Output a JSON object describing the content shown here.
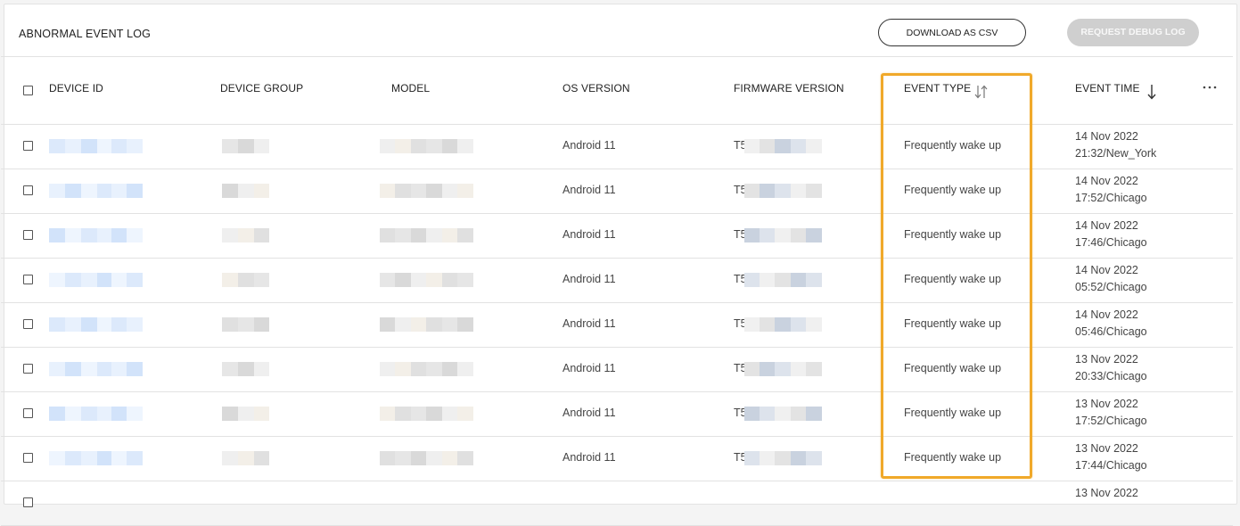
{
  "page": {
    "title": "ABNORMAL EVENT LOG",
    "download_label": "DOWNLOAD AS CSV",
    "debug_label": "REQUEST DEBUG LOG"
  },
  "columns": {
    "device_id": "DEVICE ID",
    "device_group": "DEVICE GROUP",
    "model": "MODEL",
    "os_version": "OS VERSION",
    "firmware_version": "FIRMWARE VERSION",
    "event_type": "EVENT TYPE",
    "event_time": "EVENT TIME"
  },
  "icons": {
    "event_type_sort": "sort-both-icon",
    "event_time_sort": "sort-descending-icon",
    "column_menu": "more-horizontal-icon"
  },
  "colors": {
    "highlight": "#f0a92a",
    "disabled_button": "#cfcfcf",
    "redacted_blue": "#d8e8fb",
    "redacted_gray": "#e4e4e4"
  },
  "rows": [
    {
      "os": "Android 11",
      "firmware_prefix": "T5",
      "event": "Frequently wake up",
      "date": "14 Nov 2022",
      "time": "21:32/New_York"
    },
    {
      "os": "Android 11",
      "firmware_prefix": "T5",
      "event": "Frequently wake up",
      "date": "14 Nov 2022",
      "time": "17:52/Chicago"
    },
    {
      "os": "Android 11",
      "firmware_prefix": "T5",
      "event": "Frequently wake up",
      "date": "14 Nov 2022",
      "time": "17:46/Chicago"
    },
    {
      "os": "Android 11",
      "firmware_prefix": "T5",
      "event": "Frequently wake up",
      "date": "14 Nov 2022",
      "time": "05:52/Chicago"
    },
    {
      "os": "Android 11",
      "firmware_prefix": "T5",
      "event": "Frequently wake up",
      "date": "14 Nov 2022",
      "time": "05:46/Chicago"
    },
    {
      "os": "Android 11",
      "firmware_prefix": "T5",
      "event": "Frequently wake up",
      "date": "13 Nov 2022",
      "time": "20:33/Chicago"
    },
    {
      "os": "Android 11",
      "firmware_prefix": "T5",
      "event": "Frequently wake up",
      "date": "13 Nov 2022",
      "time": "17:52/Chicago"
    },
    {
      "os": "Android 11",
      "firmware_prefix": "T5",
      "event": "Frequently wake up",
      "date": "13 Nov 2022",
      "time": "17:44/Chicago"
    },
    {
      "os": "",
      "firmware_prefix": "",
      "event": "",
      "date": "13 Nov 2022",
      "time": ""
    }
  ]
}
